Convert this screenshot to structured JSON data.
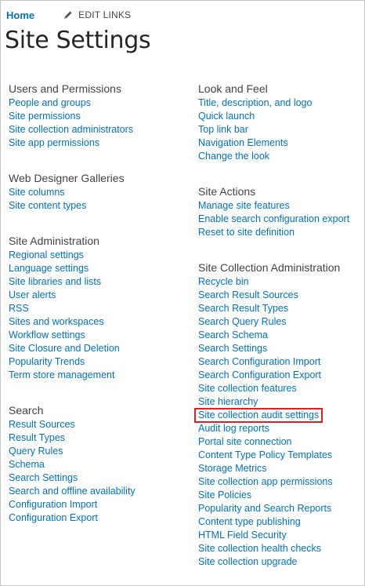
{
  "topbar": {
    "home_label": "Home",
    "edit_links_label": "EDIT LINKS"
  },
  "page_title": "Site Settings",
  "left_column": [
    {
      "heading": "Users and Permissions",
      "links": [
        "People and groups",
        "Site permissions",
        "Site collection administrators",
        "Site app permissions"
      ]
    },
    {
      "heading": "Web Designer Galleries",
      "links": [
        "Site columns",
        "Site content types"
      ]
    },
    {
      "heading": "Site Administration",
      "links": [
        "Regional settings",
        "Language settings",
        "Site libraries and lists",
        "User alerts",
        "RSS",
        "Sites and workspaces",
        "Workflow settings",
        "Site Closure and Deletion",
        "Popularity Trends",
        "Term store management"
      ]
    },
    {
      "heading": "Search",
      "links": [
        "Result Sources",
        "Result Types",
        "Query Rules",
        "Schema",
        "Search Settings",
        "Search and offline availability",
        "Configuration Import",
        "Configuration Export"
      ]
    }
  ],
  "right_column": [
    {
      "heading": "Look and Feel",
      "links": [
        "Title, description, and logo",
        "Quick launch",
        "Top link bar",
        "Navigation Elements",
        "Change the look"
      ]
    },
    {
      "heading": "Site Actions",
      "links": [
        "Manage site features",
        "Enable search configuration export",
        "Reset to site definition"
      ]
    },
    {
      "heading": "Site Collection Administration",
      "links": [
        "Recycle bin",
        "Search Result Sources",
        "Search Result Types",
        "Search Query Rules",
        "Search Schema",
        "Search Settings",
        "Search Configuration Import",
        "Search Configuration Export",
        "Site collection features",
        "Site hierarchy",
        "Site collection audit settings",
        "Audit log reports",
        "Portal site connection",
        "Content Type Policy Templates",
        "Storage Metrics",
        "Site collection app permissions",
        "Site Policies",
        "Popularity and Search Reports",
        "Content type publishing",
        "HTML Field Security",
        "Site collection health checks",
        "Site collection upgrade"
      ]
    }
  ],
  "highlighted_link": "Site collection audit settings",
  "colors": {
    "link": "#0072c6",
    "highlight_border": "#e02020"
  }
}
